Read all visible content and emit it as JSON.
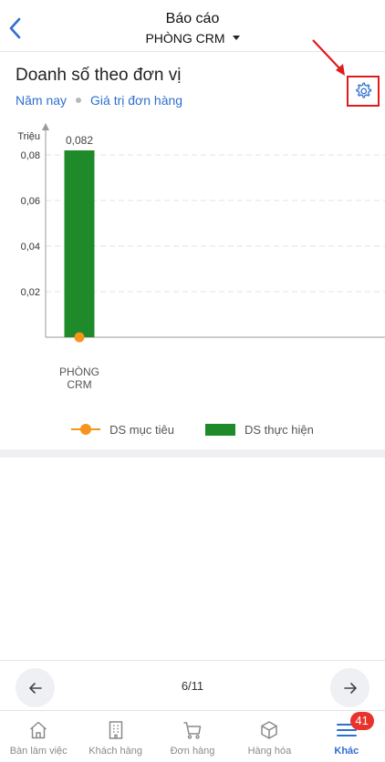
{
  "header": {
    "title": "Báo cáo",
    "subtitle": "PHÒNG CRM",
    "back_icon": "chevron-left-icon",
    "dropdown_icon": "caret-down-icon"
  },
  "report": {
    "title": "Doanh số theo đơn vị",
    "filter_period": "Năm nay",
    "filter_metric": "Giá trị đơn hàng",
    "settings_icon": "gear-icon"
  },
  "chart_data": {
    "type": "bar",
    "ylabel": "Triệu",
    "ylim": [
      0,
      0.088
    ],
    "yticks": [
      "0,02",
      "0,04",
      "0,06",
      "0,08"
    ],
    "ytick_values": [
      0.02,
      0.04,
      0.06,
      0.08
    ],
    "categories": [
      "PHÒNG CRM"
    ],
    "series": [
      {
        "name": "DS thực hiện",
        "kind": "bar",
        "color": "#1e8a2a",
        "values": [
          0.082
        ],
        "labels": [
          "0,082"
        ]
      },
      {
        "name": "DS mục tiêu",
        "kind": "line",
        "color": "#f7941d",
        "values": [
          0
        ]
      }
    ]
  },
  "legend": {
    "target_label": "DS mục tiêu",
    "actual_label": "DS thực hiện"
  },
  "pager": {
    "label": "6/11",
    "prev_icon": "arrow-left-icon",
    "next_icon": "arrow-right-icon"
  },
  "tabbar": {
    "items": [
      {
        "label": "Bàn làm việc",
        "icon": "home-icon"
      },
      {
        "label": "Khách hàng",
        "icon": "building-icon"
      },
      {
        "label": "Đơn hàng",
        "icon": "cart-icon"
      },
      {
        "label": "Hàng hóa",
        "icon": "box-icon"
      },
      {
        "label": "Khác",
        "icon": "menu-icon",
        "badge": "41",
        "active": true
      }
    ]
  },
  "colors": {
    "accent": "#2d6fd1",
    "annotation": "#e01b1b",
    "bar": "#1e8a2a",
    "target": "#f7941d",
    "badge": "#e8322b"
  }
}
